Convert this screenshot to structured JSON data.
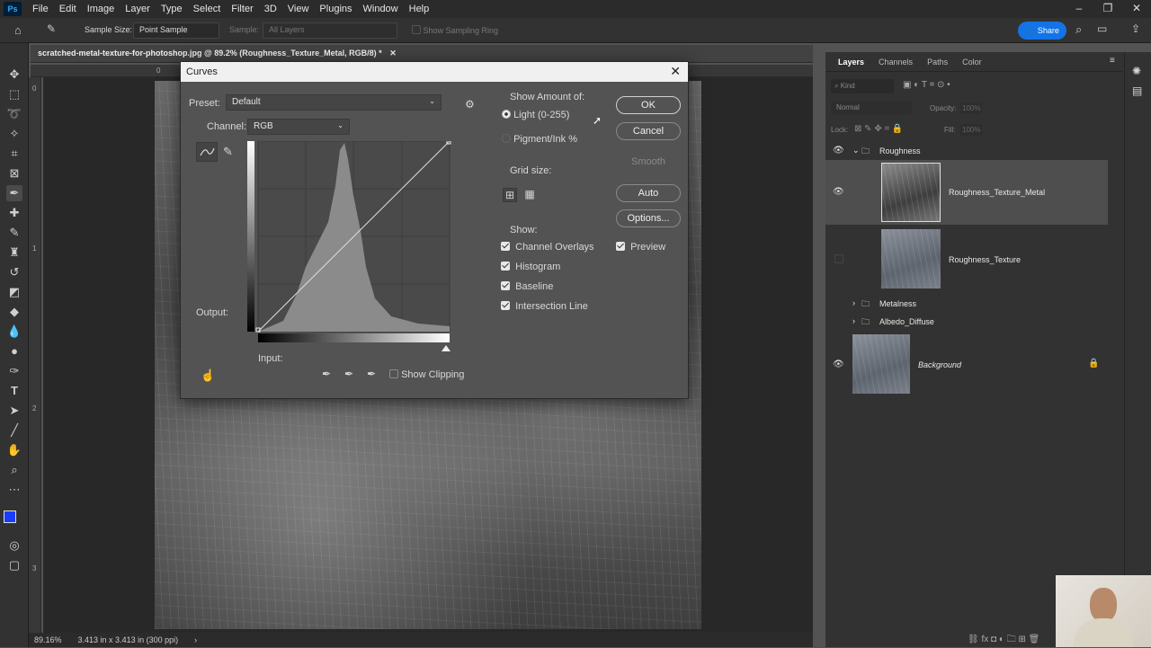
{
  "menu": {
    "items": [
      "File",
      "Edit",
      "Image",
      "Layer",
      "Type",
      "Select",
      "Filter",
      "3D",
      "View",
      "Plugins",
      "Window",
      "Help"
    ]
  },
  "options_bar": {
    "sample_size_label": "Sample Size:",
    "sample_size_value": "Point Sample",
    "sample_label": "Sample:",
    "sample_value": "All Layers",
    "show_ring": "Show Sampling Ring",
    "share": "Share"
  },
  "document": {
    "tab_title": "scratched-metal-texture-for-photoshop.jpg @ 89.2% (Roughness_Texture_Metal, RGB/8) *",
    "zoom": "89.16%",
    "doc_info": "3.413 in x 3.413 in (300 ppi)",
    "ruler_top_zero": "0",
    "ruler_left": [
      "0",
      "1",
      "2",
      "3"
    ]
  },
  "curves": {
    "title": "Curves",
    "preset_label": "Preset:",
    "preset_value": "Default",
    "channel_label": "Channel:",
    "channel_value": "RGB",
    "output_label": "Output:",
    "input_label": "Input:",
    "show_clipping": "Show Clipping",
    "show_amount_label": "Show Amount of:",
    "light_label": "Light  (0-255)",
    "pigment_label": "Pigment/Ink %",
    "grid_size_label": "Grid size:",
    "show_label": "Show:",
    "channel_overlays": "Channel Overlays",
    "histogram": "Histogram",
    "baseline": "Baseline",
    "intersection_line": "Intersection Line",
    "ok": "OK",
    "cancel": "Cancel",
    "smooth": "Smooth",
    "auto": "Auto",
    "options": "Options...",
    "preview": "Preview"
  },
  "layers_panel": {
    "tabs": [
      "Layers",
      "Channels",
      "Paths",
      "Color"
    ],
    "kind": "Kind",
    "blend": "Normal",
    "opacity_label": "Opacity:",
    "opacity": "100%",
    "lock_label": "Lock:",
    "fill_label": "Fill:",
    "fill": "100%",
    "groups": {
      "roughness": "Roughness",
      "metalness": "Metalness",
      "albedo": "Albedo_Diffuse"
    },
    "layers": {
      "metal": "Roughness_Texture_Metal",
      "texture": "Roughness_Texture",
      "background": "Background"
    }
  },
  "colors": {
    "accent": "#1473e6",
    "fg": "#1a3cff",
    "bg": "#000000"
  }
}
